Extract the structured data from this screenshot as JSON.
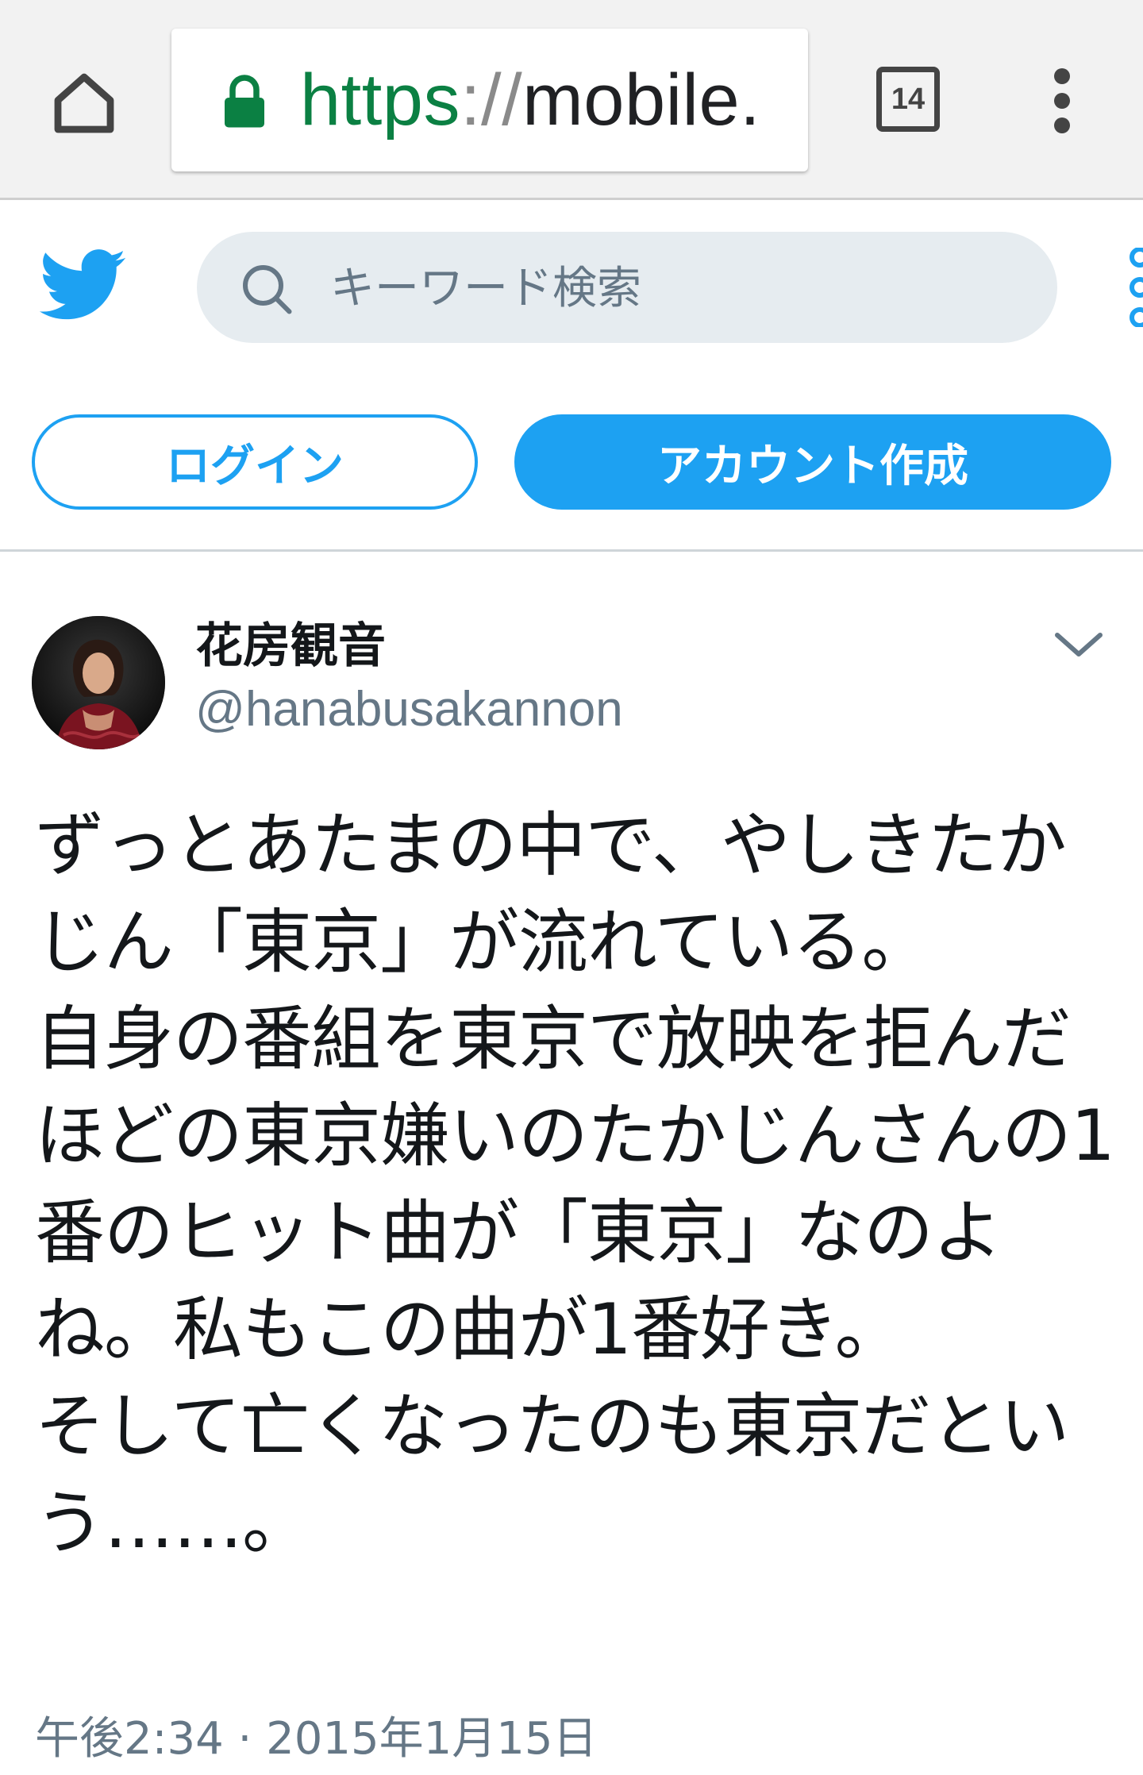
{
  "browser": {
    "url_scheme": "https",
    "url_separator": "://",
    "url_host": "mobile.",
    "tab_count": "14"
  },
  "header": {
    "logo_icon": "twitter-bird-icon",
    "search_placeholder": "キーワード検索",
    "brand_color": "#1da1f2"
  },
  "auth": {
    "login_label": "ログイン",
    "signup_label": "アカウント作成"
  },
  "tweet": {
    "display_name": "花房観音",
    "handle": "@hanabusakannon",
    "text": "ずっとあたまの中で、やしきたかじん「東京」が流れている。\n自身の番組を東京で放映を拒んだほどの東京嫌いのたかじんさんの1番のヒット曲が「東京」なのよね。私もこの曲が1番好き。\nそして亡くなったのも東京だという……。",
    "timestamp": "午後2:34 · 2015年1月15日"
  }
}
